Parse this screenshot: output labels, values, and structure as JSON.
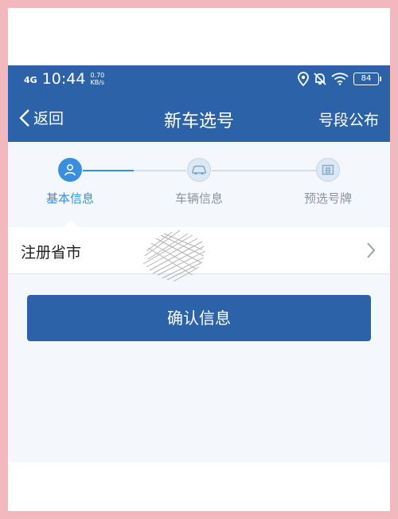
{
  "status_bar": {
    "signal": "4G",
    "time": "10:44",
    "speed_value": "0.70",
    "speed_unit": "KB/s",
    "battery": "84"
  },
  "navbar": {
    "back_label": "返回",
    "title": "新车选号",
    "right_action": "号段公布"
  },
  "steps": [
    {
      "label": "基本信息",
      "icon": "user-icon",
      "active": true
    },
    {
      "label": "车辆信息",
      "icon": "car-icon",
      "active": false
    },
    {
      "label": "预选号牌",
      "icon": "plate-icon",
      "active": false
    }
  ],
  "form": {
    "province_label": "注册省市"
  },
  "confirm_button": "确认信息",
  "colors": {
    "primary": "#2c63a8",
    "accent": "#3a8fdc",
    "page_border": "#f2b8be"
  }
}
